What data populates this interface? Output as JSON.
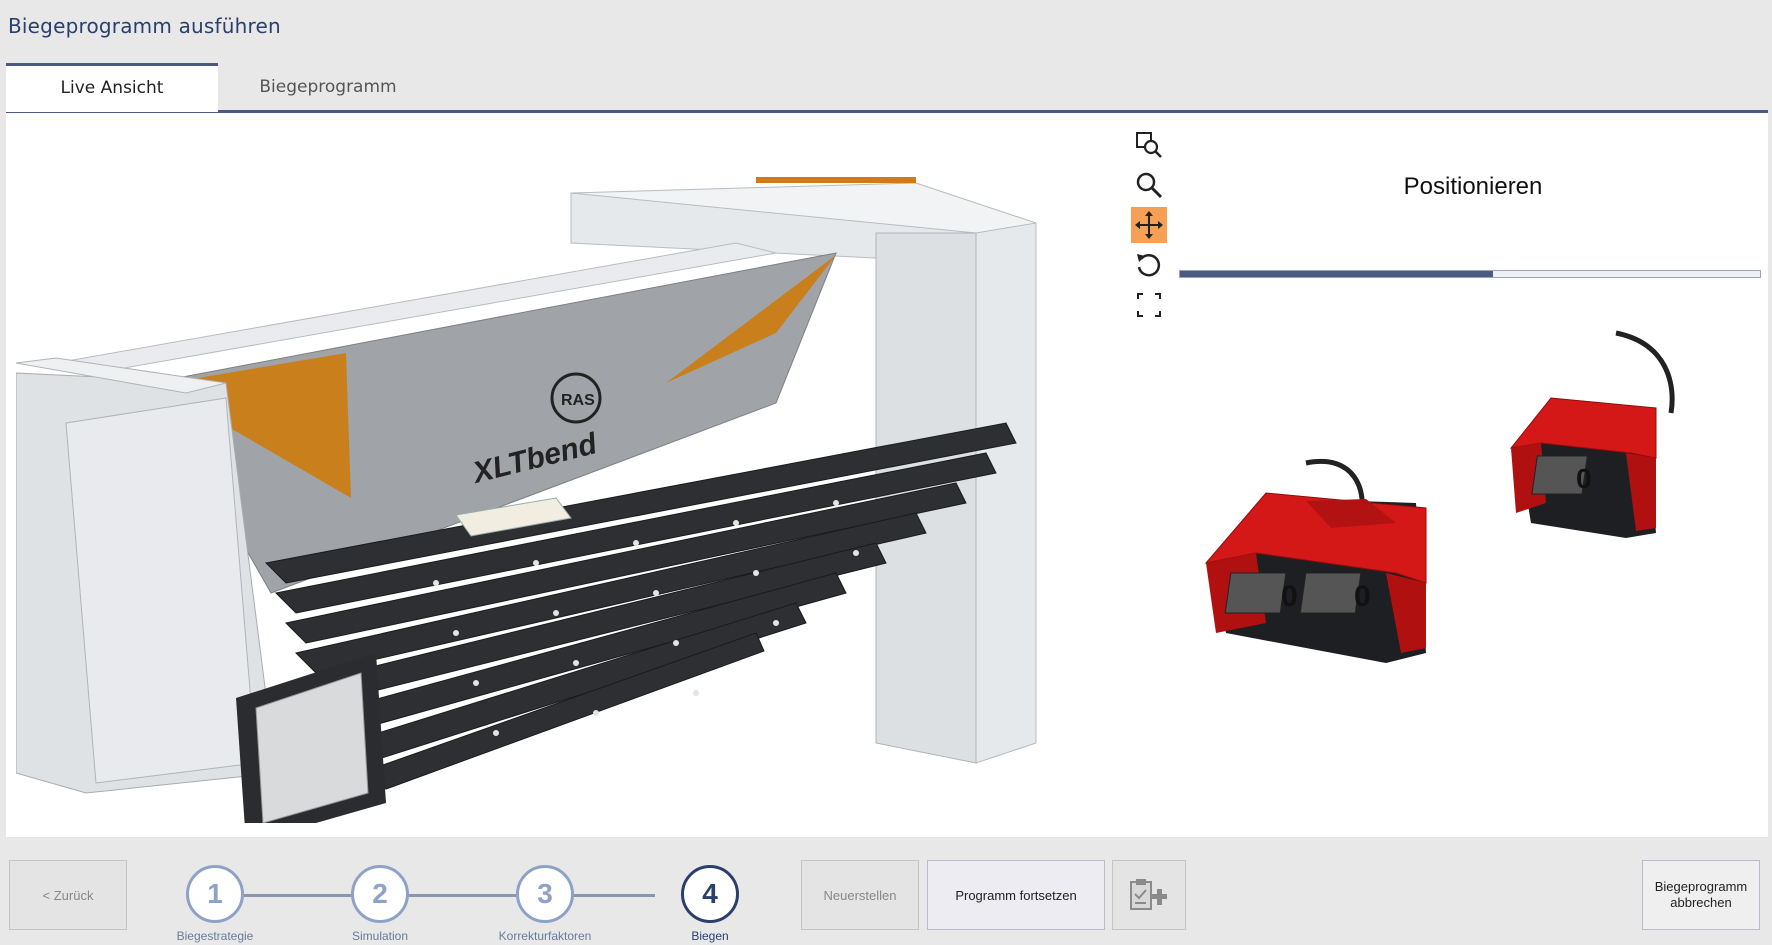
{
  "window": {
    "title": "Biegeprogramm ausführen"
  },
  "tabs": [
    {
      "label": "Live Ansicht",
      "active": true
    },
    {
      "label": "Biegeprogramm",
      "active": false
    }
  ],
  "machine": {
    "logo_text": "XLTbend",
    "seal_text": "RAS"
  },
  "toolbar": {
    "tools": [
      {
        "icon": "zoom-window-icon"
      },
      {
        "icon": "zoom-icon"
      },
      {
        "icon": "pan-move-icon",
        "active": true
      },
      {
        "icon": "rotate-icon"
      },
      {
        "icon": "fit-screen-icon"
      }
    ]
  },
  "status": {
    "label": "Positionieren",
    "progress": 0.54
  },
  "pedals": {
    "left_keys": [
      "0",
      "0"
    ],
    "right_keys": [
      "0"
    ]
  },
  "footer": {
    "back_label": "< Zurück",
    "reset_label": "Neuerstellen",
    "continue_label": "Programm fortsetzen",
    "abort_line1": "Biegeprogramm",
    "abort_line2": "abbrechen",
    "clipboard_icon": "clipboard-add-icon"
  },
  "steps": [
    {
      "number": "1",
      "label": "Biegestrategie"
    },
    {
      "number": "2",
      "label": "Simulation"
    },
    {
      "number": "3",
      "label": "Korrekturfaktoren"
    },
    {
      "number": "4",
      "label": "Biegen",
      "current": true
    }
  ],
  "colors": {
    "accent": "#2a3f6e",
    "active_tool": "#f5a055",
    "machine_orange": "#c9801c",
    "pedal_red": "#d41818"
  }
}
